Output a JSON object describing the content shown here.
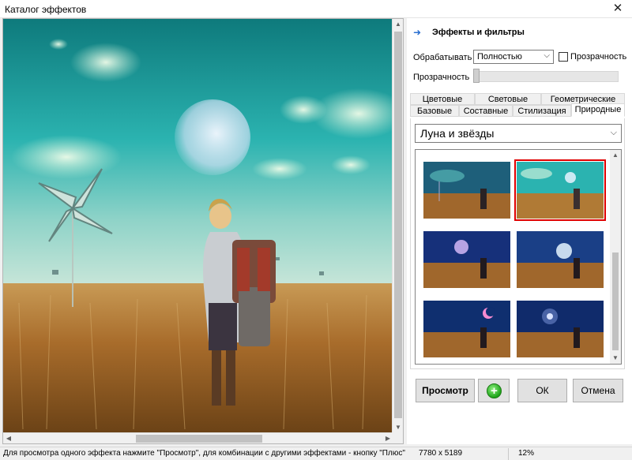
{
  "window": {
    "title": "Каталог эффектов",
    "close_icon": "close-icon"
  },
  "panel": {
    "header": "Эффекты и фильтры",
    "process_label": "Обрабатывать",
    "process_value": "Полностью",
    "transparency_checkbox_label": "Прозрачность",
    "transparency_checked": false,
    "transparency_label": "Прозрачность",
    "transparency_level": 0
  },
  "tabs": {
    "row_top": [
      "Цветовые",
      "Световые",
      "Геометрические"
    ],
    "row_bottom": [
      "Базовые",
      "Составные",
      "Стилизация",
      "Природные"
    ],
    "active": "Природные"
  },
  "category": {
    "selected": "Луна и звёзды"
  },
  "thumbnails": {
    "selected_index": 1,
    "count": 6
  },
  "buttons": {
    "preview": "Просмотр",
    "plus_icon": "plus-circle-icon",
    "ok": "ОК",
    "cancel": "Отмена"
  },
  "status": {
    "hint": "Для просмотра одного эффекта нажмите \"Просмотр\", для комбинации с другими эффектами - кнопку \"Плюс\"",
    "dimensions": "7780 x 5189",
    "zoom": "12%"
  },
  "colors": {
    "accent": "#2a6fd0",
    "selection": "#e00000",
    "sky_teal": "#2bb3b0",
    "field_gold": "#b07a35"
  }
}
